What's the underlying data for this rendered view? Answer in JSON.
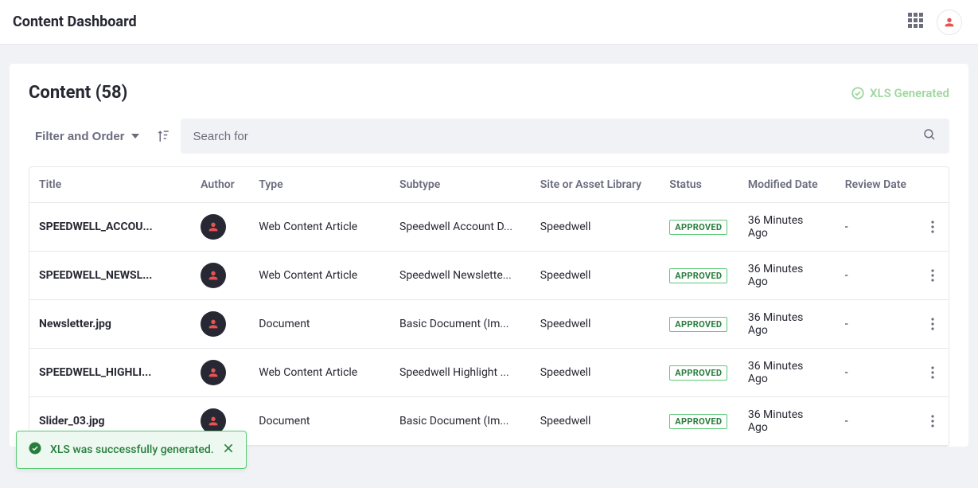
{
  "header": {
    "title": "Content Dashboard"
  },
  "panel": {
    "title": "Content (58)",
    "xls_status": "XLS Generated"
  },
  "toolbar": {
    "filter_label": "Filter and Order",
    "search_placeholder": "Search for"
  },
  "columns": {
    "title": "Title",
    "author": "Author",
    "type": "Type",
    "subtype": "Subtype",
    "site": "Site or Asset Library",
    "status": "Status",
    "modified": "Modified Date",
    "review": "Review Date"
  },
  "rows": [
    {
      "title": "SPEEDWELL_ACCOU...",
      "type": "Web Content Article",
      "subtype": "Speedwell Account D...",
      "site": "Speedwell",
      "status": "APPROVED",
      "modified": "36 Minutes Ago",
      "review": "-"
    },
    {
      "title": "SPEEDWELL_NEWSL...",
      "type": "Web Content Article",
      "subtype": "Speedwell Newslette...",
      "site": "Speedwell",
      "status": "APPROVED",
      "modified": "36 Minutes Ago",
      "review": "-"
    },
    {
      "title": "Newsletter.jpg",
      "type": "Document",
      "subtype": "Basic Document (Im...",
      "site": "Speedwell",
      "status": "APPROVED",
      "modified": "36 Minutes Ago",
      "review": "-"
    },
    {
      "title": "SPEEDWELL_HIGHLI...",
      "type": "Web Content Article",
      "subtype": "Speedwell Highlight ...",
      "site": "Speedwell",
      "status": "APPROVED",
      "modified": "36 Minutes Ago",
      "review": "-"
    },
    {
      "title": "Slider_03.jpg",
      "type": "Document",
      "subtype": "Basic Document (Im...",
      "site": "Speedwell",
      "status": "APPROVED",
      "modified": "36 Minutes Ago",
      "review": "-"
    }
  ],
  "toast": {
    "message": "XLS was successfully generated."
  }
}
